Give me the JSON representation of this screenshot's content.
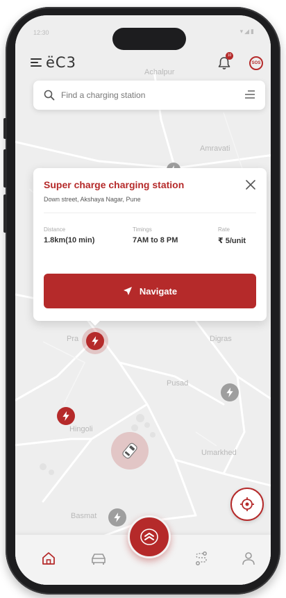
{
  "status_bar": {
    "time": "12:30",
    "icons": "▾◢▮"
  },
  "header": {
    "logo": "ëC3",
    "notification_count": "10",
    "sos_label": "SOS"
  },
  "search": {
    "placeholder": "Find a charging station"
  },
  "map_labels": {
    "achalpur": "Achalpur",
    "amravati": "Amravati",
    "pra": "Pra",
    "digras": "Digras",
    "pusad": "Pusad",
    "hingoli": "Hingoli",
    "umarkhed": "Umarkhed",
    "basmat": "Basmat"
  },
  "station_card": {
    "title": "Super charge charging station",
    "address": "Down street, Akshaya Nagar, Pune",
    "stats": [
      {
        "label": "Distance",
        "value": "1.8km(10 min)"
      },
      {
        "label": "Timings",
        "value": "7AM to 8 PM"
      },
      {
        "label": "Rate",
        "value": "₹ 5/unit"
      }
    ],
    "navigate_label": "Navigate"
  },
  "colors": {
    "accent": "#b52a2a",
    "map_bg": "#eeeeee",
    "pin_gray": "#9e9e9e"
  },
  "bottom_nav": {
    "items": [
      "home-icon",
      "car-icon",
      "charge-center-icon",
      "route-icon",
      "profile-icon"
    ],
    "active": "home-icon"
  }
}
